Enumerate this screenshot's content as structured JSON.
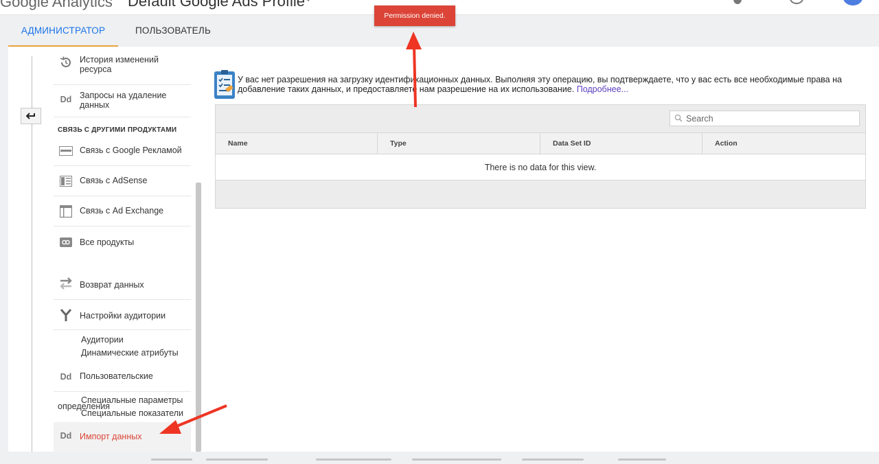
{
  "header": {
    "brand": "Google Analytics",
    "property_title": "Default Google Ads Profile"
  },
  "tabs": [
    {
      "label": "АДМИНИСТРАТОР",
      "active": true
    },
    {
      "label": "ПОЛЬЗОВАТЕЛЬ",
      "active": false
    }
  ],
  "toast": {
    "text": "Permission denied.",
    "color": "#db4437"
  },
  "sidebar": {
    "history": "История изменений ресурса",
    "deletion": "Запросы на удаление данных",
    "section_title": "СВЯЗЬ С ДРУГИМИ ПРОДУКТАМИ",
    "links": [
      {
        "label": "Связь с Google Рекламой",
        "icon": "ads-link-icon"
      },
      {
        "label": "Связь с AdSense",
        "icon": "adsense-icon"
      },
      {
        "label": "Связь с Ad Exchange",
        "icon": "ad-exchange-icon"
      },
      {
        "label": "Все продукты",
        "icon": "all-products-link-icon"
      }
    ],
    "postbacks": "Возврат данных",
    "audience_settings": "Настройки аудитории",
    "audiences": "Аудитории",
    "dynamic_attributes": "Динамические атрибуты",
    "custom": "Пользовательские определения",
    "custom_dimensions": "Специальные параметры",
    "custom_metrics": "Специальные показатели",
    "data_import": "Импорт данных"
  },
  "notice": {
    "text": "У вас нет разрешения на загрузку идентификационных данных. Выполняя эту операцию, вы подтверждаете, что у вас есть все необходимые права на добавление таких данных, и предоставляете нам разрешение на их использование.",
    "link": "Подробнее..."
  },
  "table": {
    "search_placeholder": "Search",
    "columns": [
      "Name",
      "Type",
      "Data Set ID",
      "Action"
    ],
    "empty_message": "There is no data for this view."
  },
  "colors": {
    "accent": "#1a73e8",
    "tab_underline": "#e8a33b",
    "active_nav": "#db4437",
    "annotation_arrow": "#ee3524"
  }
}
